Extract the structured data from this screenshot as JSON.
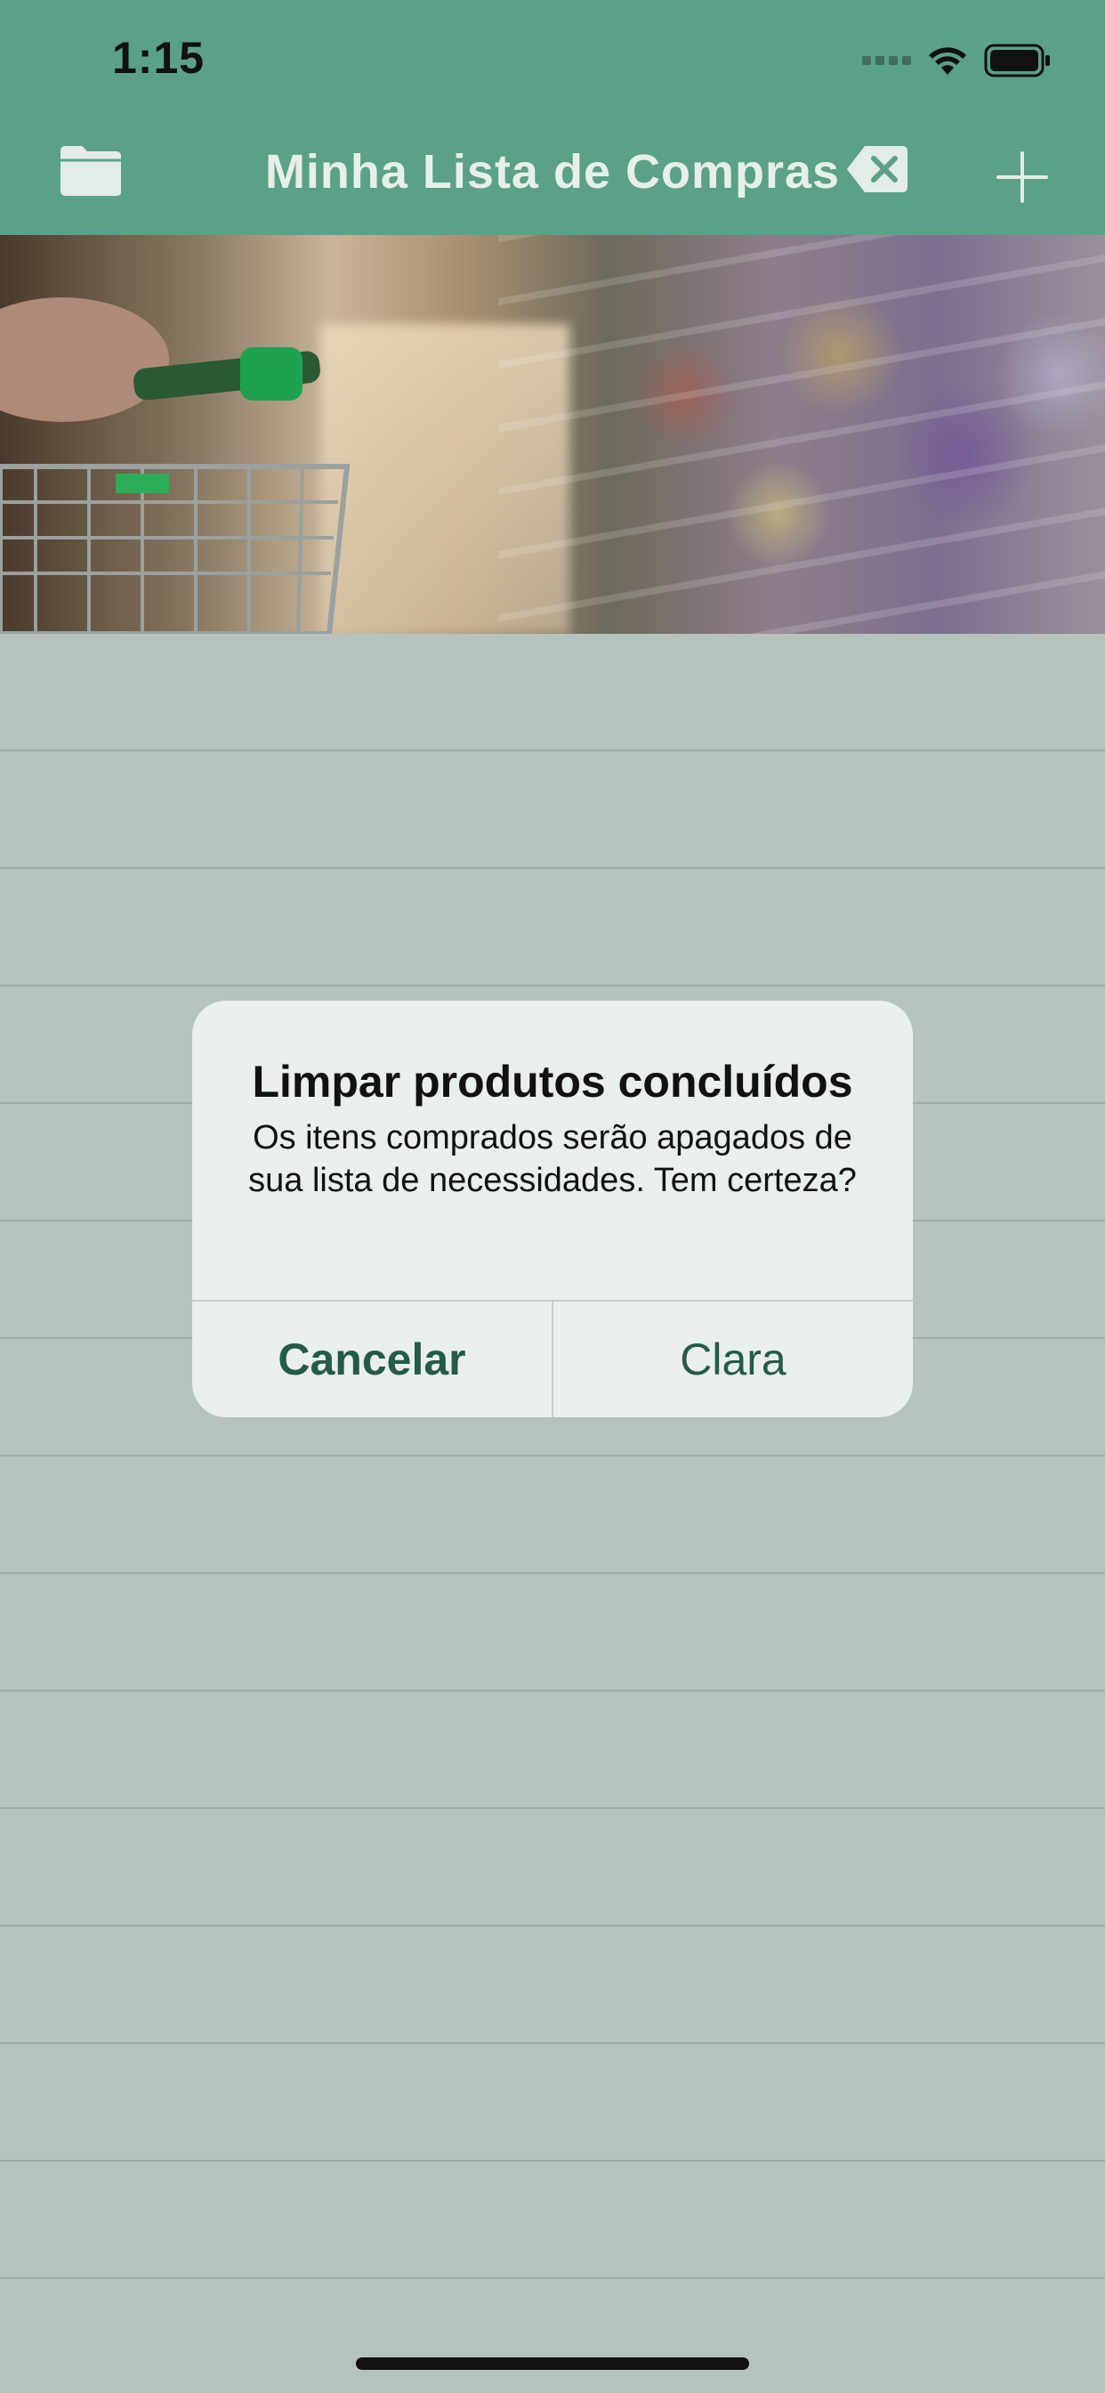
{
  "status_bar": {
    "time": "1:15"
  },
  "nav": {
    "title": "Minha Lista de Compras",
    "left_icon": "folder-icon",
    "right_icons": [
      "delete-left-icon",
      "plus-icon"
    ]
  },
  "colors": {
    "header": "#5ba187",
    "list_background": "#b6c2bc",
    "alert_background": "#e9efec",
    "accent": "#245b48"
  },
  "alert": {
    "title": "Limpar produtos concluídos",
    "message": "Os itens comprados serão apagados de sua lista de necessidades. Tem certeza?",
    "cancel_label": "Cancelar",
    "confirm_label": "Clara"
  }
}
